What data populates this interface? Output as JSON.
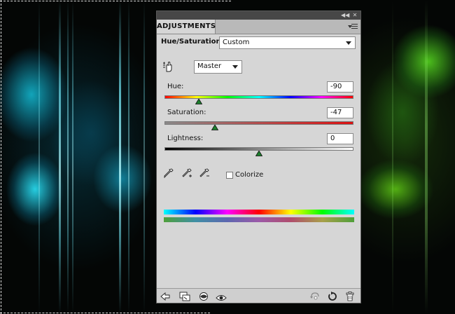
{
  "panel": {
    "tab_title": "ADJUSTMENTS",
    "adjustment_name": "Hue/Saturation",
    "preset": {
      "value": "Custom"
    },
    "channel": {
      "value": "Master"
    },
    "hue": {
      "label": "Hue:",
      "value": "-90",
      "position": 0.18
    },
    "saturation": {
      "label": "Saturation:",
      "value": "-47",
      "position": 0.265
    },
    "lightness": {
      "label": "Lightness:",
      "value": "0",
      "position": 0.5
    },
    "colorize": {
      "label": "Colorize",
      "checked": false
    }
  },
  "colors": {
    "panel_bg": "#d6d6d6",
    "titlebar": "#474747",
    "thumb": "#1c7f2c"
  },
  "icons": {
    "titlebar": [
      "collapse-icon",
      "close-icon"
    ],
    "tools": [
      "targeted-adjustment-hand-icon",
      "eyedropper-icon",
      "eyedropper-plus-icon",
      "eyedropper-minus-icon"
    ],
    "bottom_left": [
      "back-arrow-icon",
      "clip-to-layer-icon",
      "layer-visibility-mask-icon",
      "eye-icon"
    ],
    "bottom_right": [
      "view-previous-state-icon",
      "reset-icon",
      "trash-icon"
    ]
  }
}
